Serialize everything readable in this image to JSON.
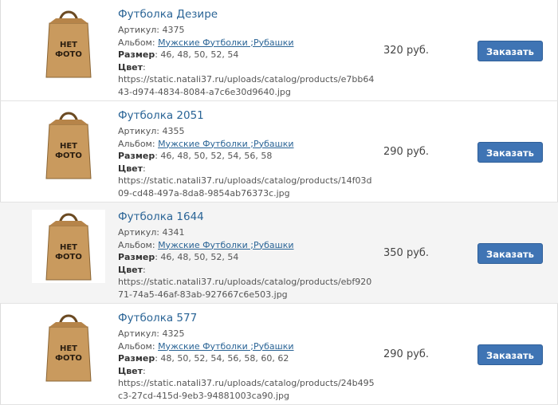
{
  "labels": {
    "sku": "Артикул:",
    "album": "Альбом:",
    "size": "Размер",
    "color": "Цвет",
    "order": "Заказать",
    "no_photo_line1": "НЕТ",
    "no_photo_line2": "ФОТО"
  },
  "products": [
    {
      "title": "Футболка Дезире",
      "sku": "4375",
      "album": "Мужские Футболки ;Рубашки",
      "sizes": "46, 48, 50, 52, 54",
      "url": "https://static.natali37.ru/uploads/catalog/products/e7bb6443-d974-4834-8084-a7c6e30d9640.jpg",
      "price": "320 руб."
    },
    {
      "title": "Футболка 2051",
      "sku": "4355",
      "album": "Мужские Футболки ;Рубашки",
      "sizes": "46, 48, 50, 52, 54, 56, 58",
      "url": "https://static.natali37.ru/uploads/catalog/products/14f03d09-cd48-497a-8da8-9854ab76373c.jpg",
      "price": "290 руб."
    },
    {
      "title": "Футболка 1644",
      "sku": "4341",
      "album": "Мужские Футболки ;Рубашки",
      "sizes": "46, 48, 50, 52, 54",
      "url": "https://static.natali37.ru/uploads/catalog/products/ebf92071-74a5-46af-83ab-927667c6e503.jpg",
      "price": "350 руб."
    },
    {
      "title": "Футболка 577",
      "sku": "4325",
      "album": "Мужские Футболки ;Рубашки",
      "sizes": "48, 50, 52, 54, 56, 58, 60, 62",
      "url": "https://static.natali37.ru/uploads/catalog/products/24b495c3-27cd-415d-9eb3-94881003ca90.jpg",
      "price": "290 руб."
    }
  ]
}
